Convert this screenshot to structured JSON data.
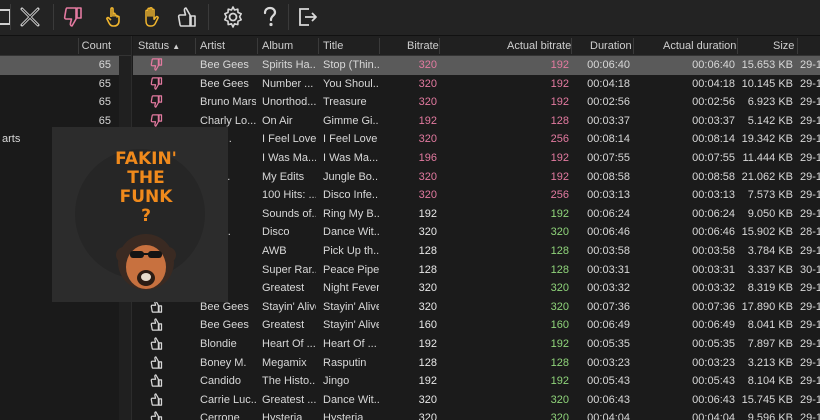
{
  "colors": {
    "pink": "#e37aa0",
    "green": "#8fd47a",
    "accent": "#e07b20"
  },
  "toolbar": {
    "buttons": [
      {
        "name": "close-x-button",
        "icon": "x-icon"
      },
      {
        "name": "thumb-down-button",
        "icon": "thumb-down-icon"
      },
      {
        "name": "hand-pointer-button",
        "icon": "hand-point-icon"
      },
      {
        "name": "hand-open-button",
        "icon": "hand-open-icon"
      },
      {
        "name": "thumb-up-button",
        "icon": "thumb-up-icon"
      },
      {
        "name": "settings-button",
        "icon": "gear-icon"
      },
      {
        "name": "help-button",
        "icon": "question-icon"
      },
      {
        "name": "exit-button",
        "icon": "exit-icon"
      }
    ]
  },
  "left_panel": {
    "count_header": "Count",
    "rows": [
      {
        "name": "",
        "count": "65",
        "selected": true
      },
      {
        "name": "",
        "count": "65"
      },
      {
        "name": "",
        "count": "65"
      },
      {
        "name": "",
        "count": "65"
      },
      {
        "name": "arts",
        "count": ""
      }
    ]
  },
  "cover": {
    "lines": [
      "FAKIN'",
      "THE",
      "FUNK",
      "?"
    ]
  },
  "table": {
    "headers": {
      "status": "Status",
      "artist": "Artist",
      "album": "Album",
      "title": "Title",
      "bitrate": "Bitrate",
      "actual_bitrate": "Actual bitrate",
      "duration": "Duration",
      "actual_duration": "Actual duration",
      "size": "Size"
    },
    "sort_indicator": "▲",
    "rows": [
      {
        "status": "down",
        "artist": "Bee Gees",
        "album": "Spirits Ha...",
        "title": "Stop (Thin...",
        "bitrate": "320",
        "bitrate_c": "pink",
        "abitrate": "192",
        "abitrate_c": "pink",
        "dur": "00:06:40",
        "adur": "00:06:40",
        "size": "15.653 KB",
        "date": "29-1",
        "selected": true
      },
      {
        "status": "down",
        "artist": "Bee Gees",
        "album": "Number ...",
        "title": "You Shoul...",
        "bitrate": "320",
        "bitrate_c": "pink",
        "abitrate": "192",
        "abitrate_c": "pink",
        "dur": "00:04:18",
        "adur": "00:04:18",
        "size": "10.145 KB",
        "date": "29-1"
      },
      {
        "status": "down",
        "artist": "Bruno Mars",
        "album": "Unorthod...",
        "title": "Treasure",
        "bitrate": "320",
        "bitrate_c": "pink",
        "abitrate": "192",
        "abitrate_c": "pink",
        "dur": "00:02:56",
        "adur": "00:02:56",
        "size": "6.923 KB",
        "date": "29-1"
      },
      {
        "status": "down",
        "artist": "Charly Lo...",
        "album": "On Air",
        "title": "Gimme Gi...",
        "bitrate": "192",
        "bitrate_c": "pink",
        "abitrate": "128",
        "abitrate_c": "pink",
        "dur": "00:03:37",
        "adur": "00:03:37",
        "size": "5.142 KB",
        "date": "29-1"
      },
      {
        "status": "down",
        "artist": "n Su...",
        "album": "I Feel Love",
        "title": "I Feel Love",
        "bitrate": "320",
        "bitrate_c": "pink",
        "abitrate": "256",
        "abitrate_c": "pink",
        "dur": "00:08:14",
        "adur": "00:08:14",
        "size": "19.342 KB",
        "date": "29-1"
      },
      {
        "status": "down",
        "artist": "",
        "album": "I Was Ma...",
        "title": "I Was Ma...",
        "bitrate": "196",
        "bitrate_c": "pink",
        "abitrate": "192",
        "abitrate_c": "pink",
        "dur": "00:07:55",
        "adur": "00:07:55",
        "size": "11.444 KB",
        "date": "29-1"
      },
      {
        "status": "down",
        "artist": "k Th...",
        "album": "My Edits",
        "title": "Jungle Bo...",
        "bitrate": "320",
        "bitrate_c": "pink",
        "abitrate": "192",
        "abitrate_c": "pink",
        "dur": "00:08:58",
        "adur": "00:08:58",
        "size": "21.062 KB",
        "date": "29-1"
      },
      {
        "status": "down",
        "artist": "ram...",
        "album": "100 Hits: ...",
        "title": "Disco Infe...",
        "bitrate": "320",
        "bitrate_c": "pink",
        "abitrate": "256",
        "abitrate_c": "pink",
        "dur": "00:03:13",
        "adur": "00:03:13",
        "size": "7.573 KB",
        "date": "29-1"
      },
      {
        "status": "up",
        "artist": "Ward",
        "album": "Sounds of...",
        "title": "Ring My B...",
        "bitrate": "192",
        "bitrate_c": "white",
        "abitrate": "192",
        "abitrate_c": "green",
        "dur": "00:06:24",
        "adur": "00:06:24",
        "size": "9.050 KB",
        "date": "29-1"
      },
      {
        "status": "up",
        "artist": "nd V...",
        "album": "Disco",
        "title": "Dance Wit...",
        "bitrate": "320",
        "bitrate_c": "white",
        "abitrate": "320",
        "abitrate_c": "green",
        "dur": "00:06:46",
        "adur": "00:06:46",
        "size": "15.902 KB",
        "date": "28-1"
      },
      {
        "status": "up",
        "artist": "ge ...",
        "album": "AWB",
        "title": "Pick Up th...",
        "bitrate": "128",
        "bitrate_c": "white",
        "abitrate": "128",
        "abitrate_c": "green",
        "dur": "00:03:58",
        "adur": "00:03:58",
        "size": "3.784 KB",
        "date": "29-1"
      },
      {
        "status": "up",
        "artist": "pre...",
        "album": "Super Rar...",
        "title": "Peace Pipe",
        "bitrate": "128",
        "bitrate_c": "white",
        "abitrate": "128",
        "abitrate_c": "green",
        "dur": "00:03:31",
        "adur": "00:03:31",
        "size": "3.337 KB",
        "date": "30-1"
      },
      {
        "status": "up",
        "artist": "ees",
        "album": "Greatest",
        "title": "Night Fever",
        "bitrate": "320",
        "bitrate_c": "white",
        "abitrate": "320",
        "abitrate_c": "green",
        "dur": "00:03:32",
        "adur": "00:03:32",
        "size": "8.319 KB",
        "date": "29-1"
      },
      {
        "status": "up",
        "artist": "Bee Gees",
        "album": "Stayin' Alive",
        "title": "Stayin' Alive",
        "bitrate": "320",
        "bitrate_c": "white",
        "abitrate": "320",
        "abitrate_c": "green",
        "dur": "00:07:36",
        "adur": "00:07:36",
        "size": "17.890 KB",
        "date": "29-1"
      },
      {
        "status": "up",
        "artist": "Bee Gees",
        "album": "Greatest",
        "title": "Stayin' Alive",
        "bitrate": "160",
        "bitrate_c": "white",
        "abitrate": "160",
        "abitrate_c": "green",
        "dur": "00:06:49",
        "adur": "00:06:49",
        "size": "8.041 KB",
        "date": "29-1"
      },
      {
        "status": "up",
        "artist": "Blondie",
        "album": "Heart Of ...",
        "title": "Heart Of ...",
        "bitrate": "192",
        "bitrate_c": "white",
        "abitrate": "192",
        "abitrate_c": "green",
        "dur": "00:05:35",
        "adur": "00:05:35",
        "size": "7.897 KB",
        "date": "29-1"
      },
      {
        "status": "up",
        "artist": "Boney M.",
        "album": "Megamix",
        "title": "Rasputin",
        "bitrate": "128",
        "bitrate_c": "white",
        "abitrate": "128",
        "abitrate_c": "green",
        "dur": "00:03:23",
        "adur": "00:03:23",
        "size": "3.213 KB",
        "date": "29-1"
      },
      {
        "status": "up",
        "artist": "Candido",
        "album": "The Histo...",
        "title": "Jingo",
        "bitrate": "192",
        "bitrate_c": "white",
        "abitrate": "192",
        "abitrate_c": "green",
        "dur": "00:05:43",
        "adur": "00:05:43",
        "size": "8.104 KB",
        "date": "29-1"
      },
      {
        "status": "up",
        "artist": "Carrie Luc...",
        "album": "Greatest ...",
        "title": "Dance Wit...",
        "bitrate": "320",
        "bitrate_c": "white",
        "abitrate": "320",
        "abitrate_c": "green",
        "dur": "00:06:43",
        "adur": "00:06:43",
        "size": "15.745 KB",
        "date": "29-1"
      },
      {
        "status": "up",
        "artist": "Cerrone",
        "album": "Hysteria",
        "title": "Hysteria",
        "bitrate": "320",
        "bitrate_c": "white",
        "abitrate": "320",
        "abitrate_c": "green",
        "dur": "00:04:04",
        "adur": "00:04:04",
        "size": "9.596 KB",
        "date": "29-1"
      }
    ]
  }
}
